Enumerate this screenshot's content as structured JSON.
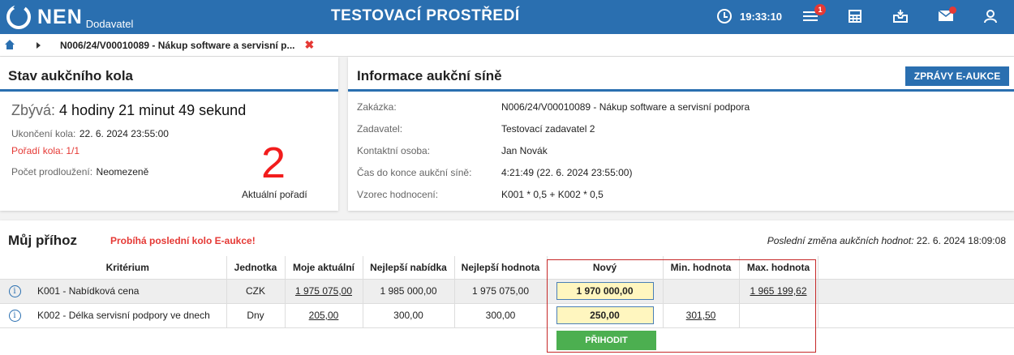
{
  "header": {
    "logo_text": "NEN",
    "logo_sub": "Dodavatel",
    "title": "TESTOVACÍ PROSTŘEDÍ",
    "time": "19:33:10",
    "notifications_count": "1",
    "icons": [
      "clock-icon",
      "menu-icon",
      "calculator-icon",
      "inbox-icon",
      "mail-icon",
      "user-icon"
    ]
  },
  "breadcrumb": {
    "text": "N006/24/V00010089 - Nákup software a servisní p...",
    "close": "✖"
  },
  "round_status": {
    "title": "Stav aukčního kola",
    "remaining_label": "Zbývá:",
    "remaining_value": "4 hodiny 21 minut 49 sekund",
    "end_label": "Ukončení kola:",
    "end_value": "22. 6. 2024 23:55:00",
    "round_order": "Pořadí kola: 1/1",
    "extensions_label": "Počet prodloužení:",
    "extensions_value": "Neomezeně",
    "rank": "2",
    "rank_label": "Aktuální pořadí"
  },
  "auction_info": {
    "title": "Informace aukční síně",
    "messages_button": "ZPRÁVY E-AUKCE",
    "rows": [
      {
        "label": "Zakázka:",
        "value": "N006/24/V00010089 - Nákup software a servisní podpora"
      },
      {
        "label": "Zadavatel:",
        "value": "Testovací zadavatel 2"
      },
      {
        "label": "Kontaktní osoba:",
        "value": "Jan Novák"
      },
      {
        "label": "Čas do konce aukční síně:",
        "value": "4:21:49 (22. 6. 2024 23:55:00)"
      },
      {
        "label": "Vzorec hodnocení:",
        "value": "K001 * 0,5 + K002 * 0,5"
      }
    ]
  },
  "my_bid": {
    "title": "Můj příhoz",
    "status": "Probíhá poslední kolo E-aukce!",
    "last_change_label": "Poslední změna aukčních hodnot:",
    "last_change_value": "22. 6. 2024 18:09:08",
    "columns": [
      "Kritérium",
      "Jednotka",
      "Moje aktuální",
      "Nejlepší nabídka",
      "Nejlepší hodnota",
      "Nový",
      "Min. hodnota",
      "Max. hodnota"
    ],
    "rows": [
      {
        "criterion": "K001 - Nabídková cena",
        "unit": "CZK",
        "my_current": "1 975 075,00",
        "best_offer": "1 985 000,00",
        "best_value": "1 975 075,00",
        "new": "1 970 000,00",
        "min": "",
        "max": "1 965 199,62"
      },
      {
        "criterion": "K002 - Délka servisní podpory ve dnech",
        "unit": "Dny",
        "my_current": "205,00",
        "best_offer": "300,00",
        "best_value": "300,00",
        "new": "250,00",
        "min": "301,50",
        "max": ""
      }
    ],
    "bid_button": "PŘIHODIT",
    "info_glyph": "i"
  },
  "colors": {
    "primary": "#2a6fb0",
    "alert": "#e53935",
    "bid_button": "#4caf50",
    "input_bg": "#fff6bf"
  }
}
